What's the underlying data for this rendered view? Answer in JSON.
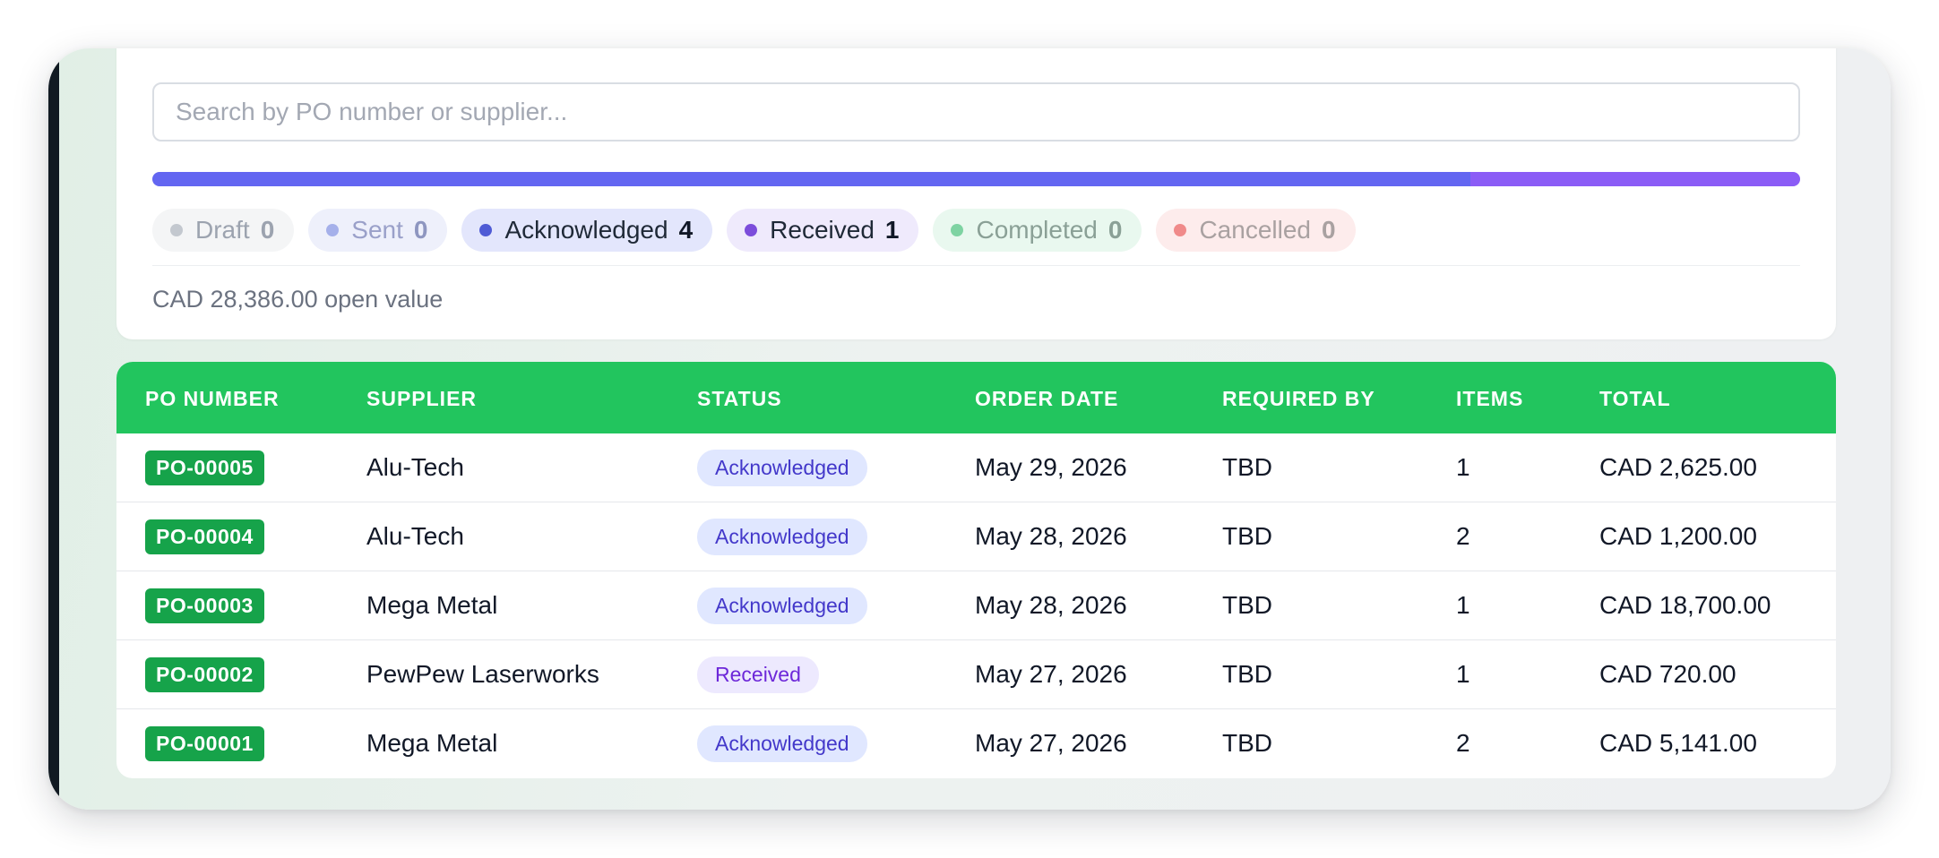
{
  "search": {
    "placeholder": "Search by PO number or supplier..."
  },
  "progress": {
    "acknowledged_fraction": 0.8,
    "received_fraction": 0.2,
    "colors": {
      "acknowledged": "#6366f1",
      "received": "#8b5cf6"
    }
  },
  "status_chips": [
    {
      "label": "Draft",
      "count": "0"
    },
    {
      "label": "Sent",
      "count": "0"
    },
    {
      "label": "Acknowledged",
      "count": "4"
    },
    {
      "label": "Received",
      "count": "1"
    },
    {
      "label": "Completed",
      "count": "0"
    },
    {
      "label": "Cancelled",
      "count": "0"
    }
  ],
  "open_value": "CAD 28,386.00 open value",
  "table": {
    "header_color": "#22c55e",
    "columns": [
      "PO NUMBER",
      "SUPPLIER",
      "STATUS",
      "ORDER DATE",
      "REQUIRED BY",
      "ITEMS",
      "TOTAL"
    ],
    "rows": [
      {
        "po": "PO-00005",
        "supplier": "Alu-Tech",
        "status": "Acknowledged",
        "order_date": "May 29, 2026",
        "required_by": "TBD",
        "items": "1",
        "total": "CAD 2,625.00"
      },
      {
        "po": "PO-00004",
        "supplier": "Alu-Tech",
        "status": "Acknowledged",
        "order_date": "May 28, 2026",
        "required_by": "TBD",
        "items": "2",
        "total": "CAD 1,200.00"
      },
      {
        "po": "PO-00003",
        "supplier": "Mega Metal",
        "status": "Acknowledged",
        "order_date": "May 28, 2026",
        "required_by": "TBD",
        "items": "1",
        "total": "CAD 18,700.00"
      },
      {
        "po": "PO-00002",
        "supplier": "PewPew Laserworks",
        "status": "Received",
        "order_date": "May 27, 2026",
        "required_by": "TBD",
        "items": "1",
        "total": "CAD 720.00"
      },
      {
        "po": "PO-00001",
        "supplier": "Mega Metal",
        "status": "Acknowledged",
        "order_date": "May 27, 2026",
        "required_by": "TBD",
        "items": "2",
        "total": "CAD 5,141.00"
      }
    ]
  }
}
